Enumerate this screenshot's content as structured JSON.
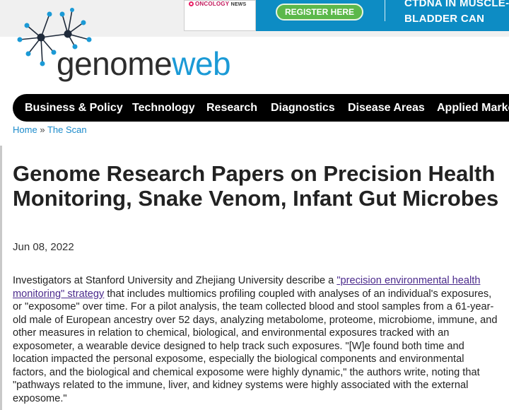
{
  "ad": {
    "brand": "ONCOLOGY",
    "brand_suffix": "NEWS",
    "button_label": "REGISTER HERE",
    "headline_line1": "CTDNA IN MUSCLE-",
    "headline_line2": "BLADDER CAN"
  },
  "logo": {
    "part1": "genome",
    "part2": "web"
  },
  "nav": {
    "items": [
      {
        "label": "Business & Policy"
      },
      {
        "label": "Technology"
      },
      {
        "label": "Research"
      },
      {
        "label": "Diagnostics"
      },
      {
        "label": "Disease Areas"
      },
      {
        "label": "Applied Markets"
      }
    ]
  },
  "breadcrumb": {
    "home": "Home",
    "separator": "»",
    "section": "The Scan"
  },
  "article": {
    "title": "Genome Research Papers on Precision Health Monitoring, Snake Venom, Infant Gut Microbes",
    "date": "Jun 08, 2022",
    "para_before_link": "Investigators at Stanford University and Zhejiang University describe a ",
    "link_text": "\"precision environmental health monitoring\" strategy",
    "para_after_link": " that includes multiomics profiling coupled with analyses of an individual's exposures, or \"exposome\" over time. For a pilot analysis, the team collected blood and stool samples from a 61-year-old male of European ancestry over 52 days, analyzing metabolome, proteome, microbiome, immune, and other measures in relation to chemical, biological, and environmental exposures tracked with an exposometer, a wearable device designed to help track such exposures. \"[W]e found both time and location impacted the personal exposome, especially the biological components and environmental factors, and the biological and chemical exposome were highly dynamic,\" the authors write, noting that \"pathways related to the immune, liver, and kidney systems were highly associated with the external exposome.\""
  },
  "colors": {
    "brand_blue": "#1b9ad6",
    "nav_bg": "#000000",
    "link": "#1a8acb",
    "visited_link": "#4b2a8c"
  }
}
